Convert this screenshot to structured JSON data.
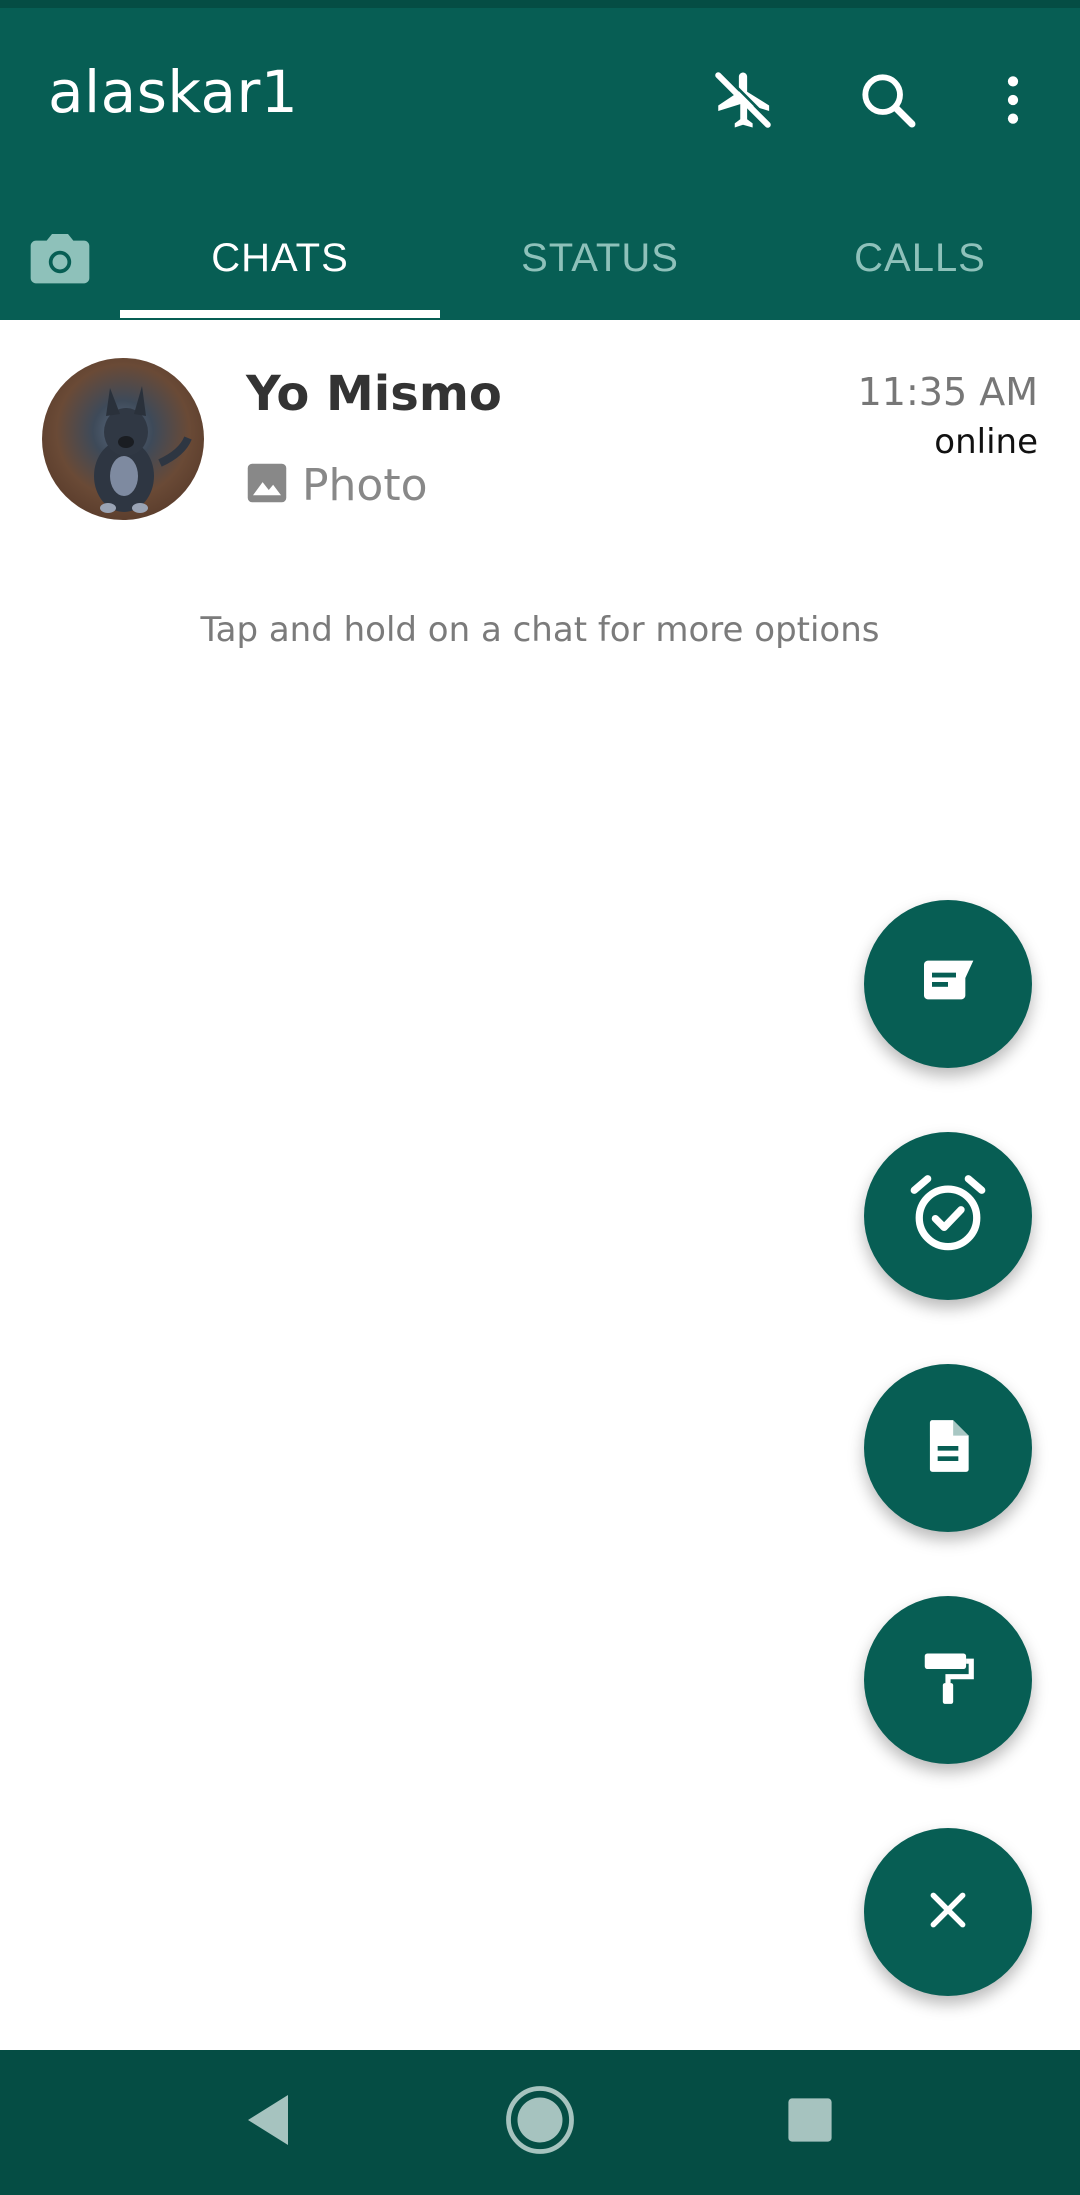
{
  "app_bar": {
    "title": "alaskar1",
    "icons": [
      "airplane-off-icon",
      "search-icon",
      "more-vert-icon"
    ]
  },
  "tabs": [
    {
      "label": "CHATS",
      "active": true
    },
    {
      "label": "STATUS",
      "active": false
    },
    {
      "label": "CALLS",
      "active": false
    }
  ],
  "chats": [
    {
      "name": "Yo Mismo",
      "time": "11:35 AM",
      "status": "online",
      "preview": "Photo",
      "preview_icon": "image-icon"
    }
  ],
  "hint_text": "Tap and hold on a chat for more options",
  "fabs": [
    "new-message",
    "reminder-alarm",
    "document",
    "paint-roller",
    "close"
  ],
  "nav": [
    "back",
    "home",
    "recents"
  ],
  "colors": {
    "primary": "#075e54",
    "primary_dark": "#054d44",
    "tab_inactive": "#8ec1ba"
  }
}
